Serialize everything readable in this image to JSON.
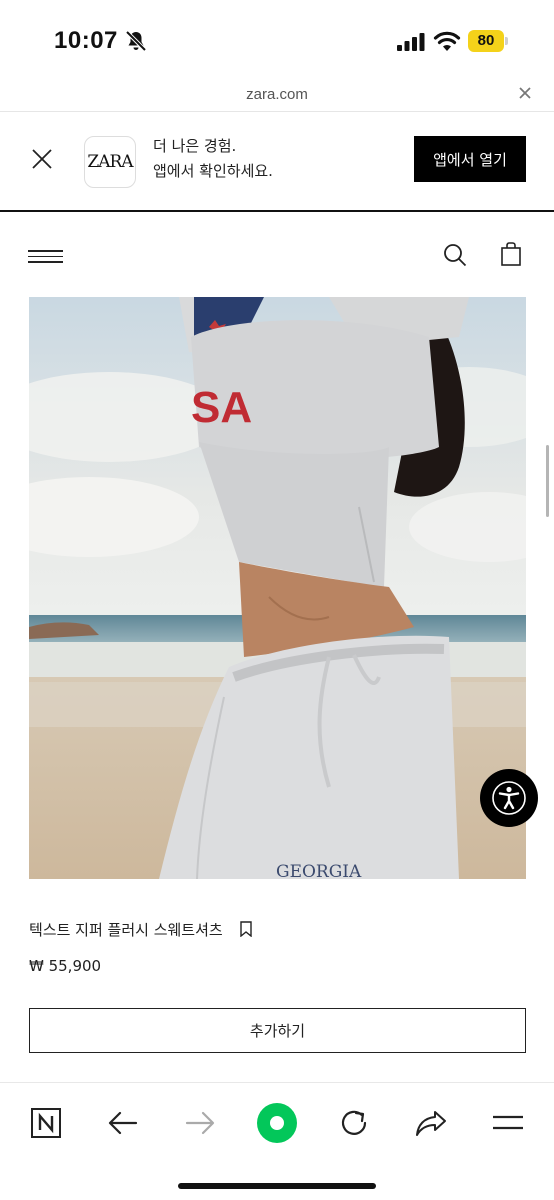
{
  "status_bar": {
    "time": "10:07",
    "battery": "80",
    "battery_color": "#f4d21a"
  },
  "url_bar": {
    "domain": "zara.com"
  },
  "app_banner": {
    "logo_text": "ZARA",
    "line1": "더 나은 경험.",
    "line2": "앱에서 확인하세요.",
    "open_button": "앱에서 열기"
  },
  "header": {
    "icons": [
      "menu-icon",
      "search-icon",
      "shopping-bag-icon"
    ]
  },
  "product": {
    "image_alt": "model wearing grey cropped zip sweatshirt and sweatpants on beach",
    "print_text": "GEORGIA",
    "name": "텍스트 지퍼 플러시 스웨트셔츠",
    "price": "₩ 55,900",
    "add_button": "추가하기"
  },
  "accessibility": {
    "icon": "accessibility-icon"
  },
  "toolbar": {
    "items": [
      "naver-home-icon",
      "back-icon",
      "forward-icon",
      "record-icon",
      "reload-icon",
      "share-icon",
      "menu-icon"
    ],
    "accent_color": "#03c75a"
  }
}
